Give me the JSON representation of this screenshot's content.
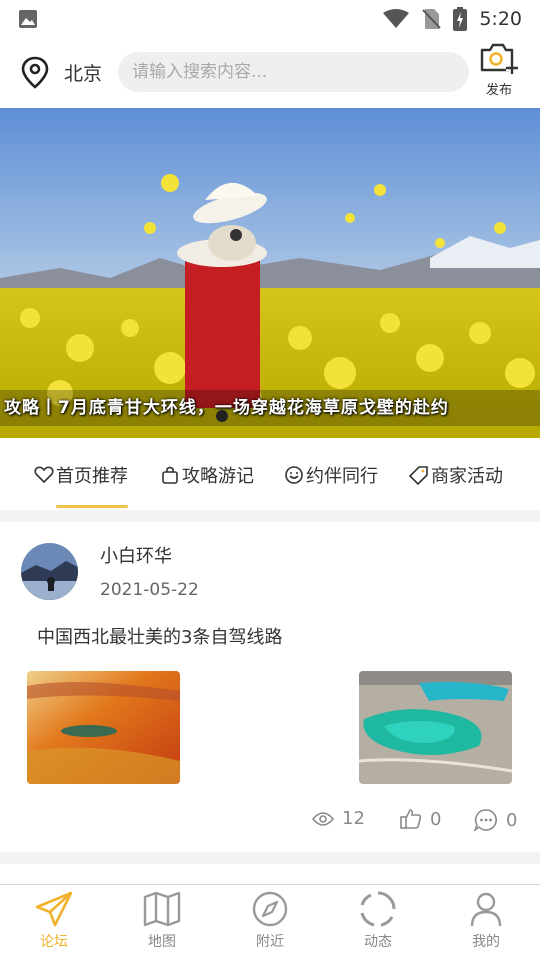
{
  "status_bar": {
    "time": "5:20",
    "icons": [
      "image-icon",
      "wifi-icon",
      "no-sim-icon",
      "battery-charging-icon"
    ]
  },
  "header": {
    "location": "北京",
    "search_placeholder": "请输入搜索内容...",
    "publish_label": "发布"
  },
  "banner": {
    "caption": "攻略丨7月底青甘大环线，一场穿越花海草原戈壁的赴约",
    "active_slide": 1
  },
  "tabs": [
    {
      "label": "首页推荐",
      "icon": "heart-icon",
      "active": true
    },
    {
      "label": "攻略游记",
      "icon": "bag-icon",
      "active": false
    },
    {
      "label": "约伴同行",
      "icon": "smile-icon",
      "active": false
    },
    {
      "label": "商家活动",
      "icon": "tag-icon",
      "active": false
    }
  ],
  "post": {
    "author": "小白环华",
    "date": "2021-05-22",
    "title": "中国西北最壮美的3条自驾线路",
    "views": "12",
    "likes": "0",
    "comments": "0"
  },
  "bottom_nav": [
    {
      "label": "论坛",
      "icon": "paper-plane-icon",
      "active": true
    },
    {
      "label": "地图",
      "icon": "map-icon",
      "active": false
    },
    {
      "label": "附近",
      "icon": "compass-icon",
      "active": false
    },
    {
      "label": "动态",
      "icon": "spinner-icon",
      "active": false
    },
    {
      "label": "我的",
      "icon": "person-icon",
      "active": false
    }
  ],
  "colors": {
    "accent": "#f0b22c",
    "underline": "#f0c34a",
    "search_bg": "#efefef",
    "page_bg": "#f3f3f3"
  }
}
